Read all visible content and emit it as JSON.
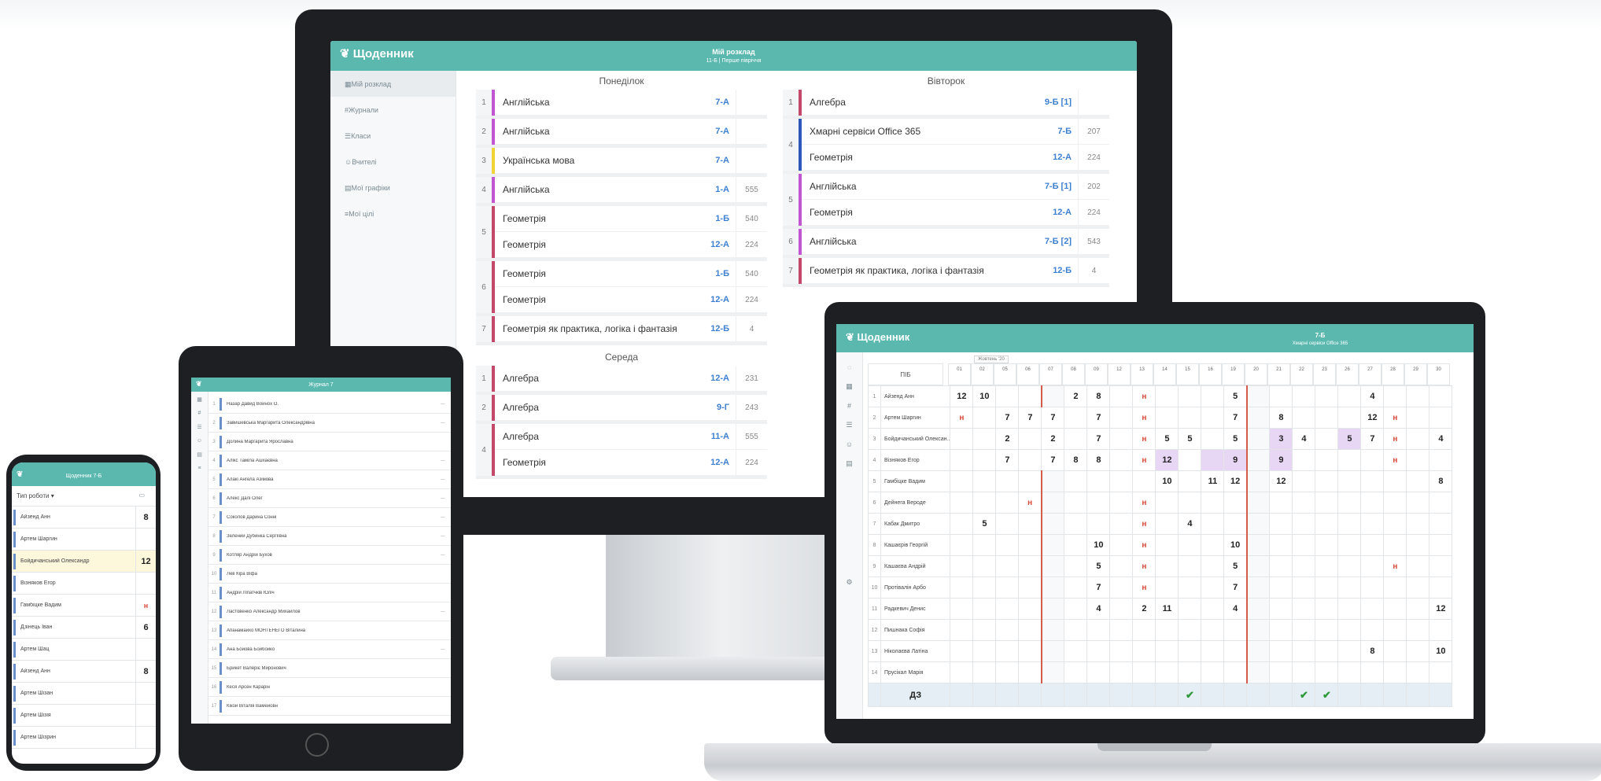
{
  "desktop": {
    "header": {
      "app_title": "Щоденник",
      "center_line1": "Мій розклад",
      "center_line2": "11-Б | Перше півріччя"
    },
    "sidebar": [
      {
        "label": "Мій розклад",
        "icon": "calendar-icon"
      },
      {
        "label": "Журнали",
        "icon": "hash-icon"
      },
      {
        "label": "Класи",
        "icon": "users-icon"
      },
      {
        "label": "Вчителі",
        "icon": "teacher-icon"
      },
      {
        "label": "Мої графіки",
        "icon": "chart-icon"
      },
      {
        "label": "Мої цілі",
        "icon": "list-icon"
      }
    ],
    "monday": {
      "title": "Понеділок",
      "lessons": [
        {
          "num": "1",
          "color": "#c256d2",
          "rows": [
            {
              "subject": "Англійська",
              "group": "7-А",
              "room": ""
            }
          ]
        },
        {
          "num": "2",
          "color": "#c256d2",
          "rows": [
            {
              "subject": "Англійська",
              "group": "7-А",
              "room": ""
            }
          ]
        },
        {
          "num": "3",
          "color": "#f0d435",
          "rows": [
            {
              "subject": "Українська мова",
              "group": "7-А",
              "room": ""
            }
          ]
        },
        {
          "num": "4",
          "color": "#c256d2",
          "rows": [
            {
              "subject": "Англійська",
              "group": "1-А",
              "room": "555"
            }
          ]
        },
        {
          "num": "5",
          "color": "#c44869",
          "rows": [
            {
              "subject": "Геометрія",
              "group": "1-Б",
              "room": "540"
            },
            {
              "subject": "Геометрія",
              "group": "12-А",
              "room": "224"
            }
          ]
        },
        {
          "num": "6",
          "color": "#c44869",
          "rows": [
            {
              "subject": "Геометрія",
              "group": "1-Б",
              "room": "540"
            },
            {
              "subject": "Геометрія",
              "group": "12-А",
              "room": "224"
            }
          ]
        },
        {
          "num": "7",
          "color": "#c44869",
          "rows": [
            {
              "subject": "Геометрія як практика, логіка і фантазія",
              "group": "12-Б",
              "room": "4"
            }
          ]
        }
      ]
    },
    "tuesday": {
      "title": "Вівторок",
      "lessons": [
        {
          "num": "1",
          "color": "#c44869",
          "rows": [
            {
              "subject": "Алгебра",
              "group": "9-Б [1]",
              "room": ""
            }
          ]
        },
        {
          "num": "4",
          "color": "#2d57b8",
          "rows": [
            {
              "subject": "Хмарні сервіси Office 365",
              "group": "7-Б",
              "room": "207"
            },
            {
              "subject": "Геометрія",
              "group": "12-А",
              "room": "224"
            }
          ]
        },
        {
          "num": "5",
          "color": "#c256d2",
          "rows": [
            {
              "subject": "Англійська",
              "group": "7-Б [1]",
              "room": "202"
            },
            {
              "subject": "Геометрія",
              "group": "12-А",
              "room": "224"
            }
          ]
        },
        {
          "num": "6",
          "color": "#c256d2",
          "rows": [
            {
              "subject": "Англійська",
              "group": "7-Б [2]",
              "room": "543"
            }
          ]
        },
        {
          "num": "7",
          "color": "#c44869",
          "rows": [
            {
              "subject": "Геометрія як практика, логіка і фантазія",
              "group": "12-Б",
              "room": "4"
            }
          ]
        }
      ]
    },
    "wednesday": {
      "title": "Середа",
      "lessons": [
        {
          "num": "1",
          "color": "#c44869",
          "rows": [
            {
              "subject": "Алгебра",
              "group": "12-А",
              "room": "231"
            }
          ]
        },
        {
          "num": "2",
          "color": "#c44869",
          "rows": [
            {
              "subject": "Алгебра",
              "group": "9-Г",
              "room": "243"
            }
          ]
        },
        {
          "num": "4",
          "color": "#c44869",
          "rows": [
            {
              "subject": "Алгебра",
              "group": "11-А",
              "room": "555"
            },
            {
              "subject": "Геометрія",
              "group": "12-А",
              "room": "224"
            }
          ]
        }
      ]
    }
  },
  "laptop": {
    "header": {
      "app_title": "Щоденник",
      "center_line1": "7-Б",
      "center_line2": "Хмарні сервіси Office 365"
    },
    "month_label": "Жовтень '20",
    "col_head": "ПІБ",
    "dates": [
      "01",
      "02",
      "05",
      "06",
      "07",
      "08",
      "09",
      "12",
      "13",
      "14",
      "15",
      "16",
      "19",
      "20",
      "21",
      "22",
      "23",
      "26",
      "27",
      "28",
      "29",
      "30"
    ],
    "students": [
      {
        "n": "1",
        "name": "Айзенд Анн",
        "cells": [
          "12",
          "10",
          "",
          "",
          "",
          "2",
          "8",
          "",
          "н",
          "",
          "",
          "",
          "5",
          "",
          "",
          "",
          "",
          "",
          "4",
          "",
          "",
          ""
        ]
      },
      {
        "n": "2",
        "name": "Артем Шаргин",
        "cells": [
          "н",
          "",
          "7",
          "7",
          "7",
          "",
          "7",
          "",
          "н",
          "",
          "",
          "",
          "7",
          "",
          "8",
          "",
          "",
          "",
          "12",
          "н",
          "",
          ""
        ]
      },
      {
        "n": "3",
        "name": "Бойдичанський Олексан..",
        "cells": [
          "",
          "",
          "2",
          "",
          "2",
          "",
          "7",
          "",
          "н",
          "5",
          "5",
          "",
          "5",
          "",
          "3",
          "4",
          "",
          "5",
          "7",
          "н",
          "",
          "4"
        ]
      },
      {
        "n": "4",
        "name": "Візняков Егор",
        "cells": [
          "",
          "",
          "7",
          "",
          "7",
          "8",
          "8",
          "",
          "н",
          "12",
          "",
          "",
          "9",
          "",
          "9",
          "",
          "",
          "",
          "",
          "н",
          "",
          ""
        ]
      },
      {
        "n": "5",
        "name": "Гамбіцке Вадим",
        "cells": [
          "",
          "",
          "",
          "",
          "",
          "",
          "",
          "",
          "",
          "10",
          "",
          "11",
          "12",
          "",
          "12",
          "",
          "",
          "",
          "",
          "",
          "",
          "8"
        ]
      },
      {
        "n": "6",
        "name": "Дейнега Вероде",
        "cells": [
          "",
          "",
          "",
          "н",
          "",
          "",
          "",
          "",
          "н",
          "",
          "",
          "",
          "",
          "",
          "",
          "",
          "",
          "",
          "",
          "",
          "",
          ""
        ]
      },
      {
        "n": "7",
        "name": "Кабак Дмитро",
        "cells": [
          "",
          "5",
          "",
          "",
          "",
          "",
          "",
          "",
          "н",
          "",
          "4",
          "",
          "",
          "",
          "",
          "",
          "",
          "",
          "",
          "",
          "",
          ""
        ]
      },
      {
        "n": "8",
        "name": "Кашаєрів Георгій",
        "cells": [
          "",
          "",
          "",
          "",
          "",
          "",
          "10",
          "",
          "н",
          "",
          "",
          "",
          "10",
          "",
          "",
          "",
          "",
          "",
          "",
          "",
          "",
          ""
        ]
      },
      {
        "n": "9",
        "name": "Кашаєва Андрій",
        "cells": [
          "",
          "",
          "",
          "",
          "",
          "",
          "5",
          "",
          "н",
          "",
          "",
          "",
          "5",
          "",
          "",
          "",
          "",
          "",
          "",
          "н",
          "",
          ""
        ]
      },
      {
        "n": "10",
        "name": "Протівалін Арбо",
        "cells": [
          "",
          "",
          "",
          "",
          "",
          "",
          "7",
          "",
          "н",
          "",
          "",
          "",
          "7",
          "",
          "",
          "",
          "",
          "",
          "",
          "",
          "",
          ""
        ]
      },
      {
        "n": "11",
        "name": "Радкевич Денис",
        "cells": [
          "",
          "",
          "",
          "",
          "",
          "",
          "4",
          "",
          "2",
          "11",
          "",
          "",
          "4",
          "",
          "",
          "",
          "",
          "",
          "",
          "",
          "",
          "12"
        ]
      },
      {
        "n": "12",
        "name": "Пишнака Софія",
        "cells": [
          "",
          "",
          "",
          "",
          "",
          "",
          "",
          "",
          "",
          "",
          "",
          "",
          "",
          "",
          "",
          "",
          "",
          "",
          "",
          "",
          "",
          ""
        ]
      },
      {
        "n": "13",
        "name": "Ніколаєва Латіна",
        "cells": [
          "",
          "",
          "",
          "",
          "",
          "",
          "",
          "",
          "",
          "",
          "",
          "",
          "",
          "",
          "",
          "",
          "",
          "",
          "8",
          "",
          "",
          "10"
        ]
      },
      {
        "n": "14",
        "name": "Прусікал Марія",
        "cells": [
          "",
          "",
          "",
          "",
          "",
          "",
          "",
          "",
          "",
          "",
          "",
          "",
          "",
          "",
          "",
          "",
          "",
          "",
          "",
          "",
          "",
          ""
        ]
      }
    ],
    "footer_label": "ДЗ",
    "check": "✔"
  },
  "tablet": {
    "header_title": "Журнал 7",
    "rows": [
      {
        "n": "1",
        "name": "Назар Давид Войнох О.",
        "mark": "—"
      },
      {
        "n": "2",
        "name": "Завишевська Маргарита Олександрівна",
        "mark": "—"
      },
      {
        "n": "3",
        "name": "Долина Маргарита Ярославна",
        "mark": ""
      },
      {
        "n": "4",
        "name": "Алікс Таміла Ашхаєвна",
        "mark": "—"
      },
      {
        "n": "5",
        "name": "Алакі Ангела Азімова",
        "mark": "—"
      },
      {
        "n": "6",
        "name": "Алекс Далі Олег",
        "mark": "—"
      },
      {
        "n": "7",
        "name": "Соколов Дарина Сонні",
        "mark": "—"
      },
      {
        "n": "8",
        "name": "Зелений Дубинка Сергіївна",
        "mark": "—"
      },
      {
        "n": "9",
        "name": "Котляр Андрій Бухов",
        "mark": "—"
      },
      {
        "n": "10",
        "name": "Лев Кіра Віфа",
        "mark": ""
      },
      {
        "n": "11",
        "name": "Андрій Ліпатчків Юліч",
        "mark": ""
      },
      {
        "n": "12",
        "name": "Ластовенко Александр Михайлов",
        "mark": "—"
      },
      {
        "n": "13",
        "name": "Апанамайхо МОНТЕНЕГО Віталина",
        "mark": ""
      },
      {
        "n": "14",
        "name": "Ана Бойова Бойбойко",
        "mark": "—"
      },
      {
        "n": "15",
        "name": "Брикет Валеріє Миронович",
        "mark": ""
      },
      {
        "n": "16",
        "name": "Кеся Арсен Карарін",
        "mark": ""
      },
      {
        "n": "17",
        "name": "Кікой Віталія Вамейовн",
        "mark": ""
      }
    ]
  },
  "phone": {
    "header_title": "Щоденник 7-Б",
    "toolbar": "Тип роботи",
    "rows": [
      {
        "name": "Айзенд Анн",
        "grade": "8"
      },
      {
        "name": "Артем Шаргин",
        "grade": ""
      },
      {
        "name": "Бойдичанський Олександр",
        "grade": "12"
      },
      {
        "name": "Візняков Егор",
        "grade": ""
      },
      {
        "name": "Гамбіцке Вадим",
        "grade": "н"
      },
      {
        "name": "Дзінець Іван",
        "grade": "6"
      },
      {
        "name": "Артем Шац",
        "grade": ""
      },
      {
        "name": "Айзенд Анн",
        "grade": "8"
      },
      {
        "name": "Артем Шізан",
        "grade": ""
      },
      {
        "name": "Артем Шізія",
        "grade": ""
      },
      {
        "name": "Артем Шізрин",
        "grade": ""
      }
    ]
  }
}
